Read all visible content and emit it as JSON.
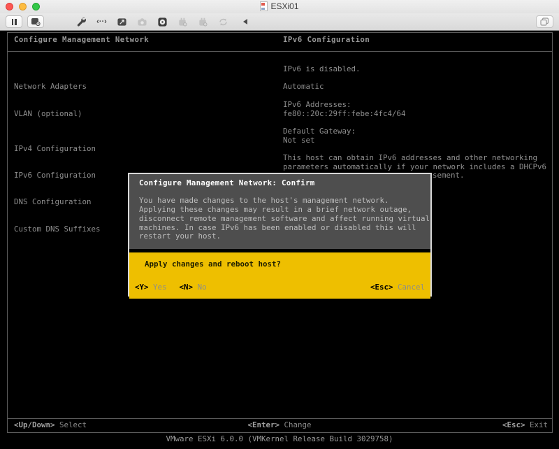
{
  "window": {
    "title": "ESXi01"
  },
  "icons": {
    "traffic_lights": [
      "close",
      "minimize",
      "zoom"
    ],
    "toolbar": [
      "pause-icon",
      "snapshot-icon",
      "wrench-icon",
      "network-adapter-icon",
      "hard-disk-icon",
      "camera-icon",
      "cd-dvd-icon",
      "usb-device-icon",
      "usb-device-2-icon",
      "sync-icon",
      "collapse-toolbar-icon",
      "overlap-windows-icon"
    ],
    "network_glyph": "‹··›"
  },
  "colors": {
    "dialog_yellow": "#eebf00",
    "dialog_gray": "#4e4e4e",
    "console_text": "#8f8f8f",
    "console_background": "#000000"
  },
  "console": {
    "header": {
      "left": "Configure Management Network",
      "right": "IPv6 Configuration"
    },
    "menu": {
      "items": [
        "Network Adapters",
        "VLAN (optional)",
        "IPv4 Configuration",
        "IPv6 Configuration",
        "DNS Configuration",
        "Custom DNS Suffixes"
      ]
    },
    "ipv6_panel": {
      "lines": [
        "IPv6 is disabled.",
        "",
        "Automatic",
        "",
        "IPv6 Addresses:",
        "fe80::20c:29ff:febe:4fc4/64",
        "",
        "Default Gateway:",
        "Not set",
        "",
        "This host can obtain IPv6 addresses and other networking",
        "parameters automatically if your network includes a DHCPv6"
      ]
    },
    "obscured_fragment": "sement.",
    "dialog": {
      "title": "Configure Management Network: Confirm",
      "body_lines": [
        "You have made changes to the host's management network.",
        "Applying these changes may result in a brief network outage,",
        "disconnect remote management software and affect running virtual",
        "machines. In case IPv6 has been enabled or disabled this will",
        "restart your host."
      ],
      "question": "Apply changes and reboot host?",
      "actions": [
        {
          "key": "<Y>",
          "label": "Yes"
        },
        {
          "key": "<N>",
          "label": "No"
        }
      ],
      "cancel": {
        "key": "<Esc>",
        "label": "Cancel"
      }
    },
    "help_bar": {
      "select": {
        "key": "<Up/Down>",
        "label": "Select"
      },
      "change": {
        "key": "<Enter>",
        "label": "Change"
      },
      "exit": {
        "key": "<Esc>",
        "label": "Exit"
      }
    },
    "footer": "VMware ESXi 6.0.0 (VMKernel Release Build 3029758)"
  }
}
